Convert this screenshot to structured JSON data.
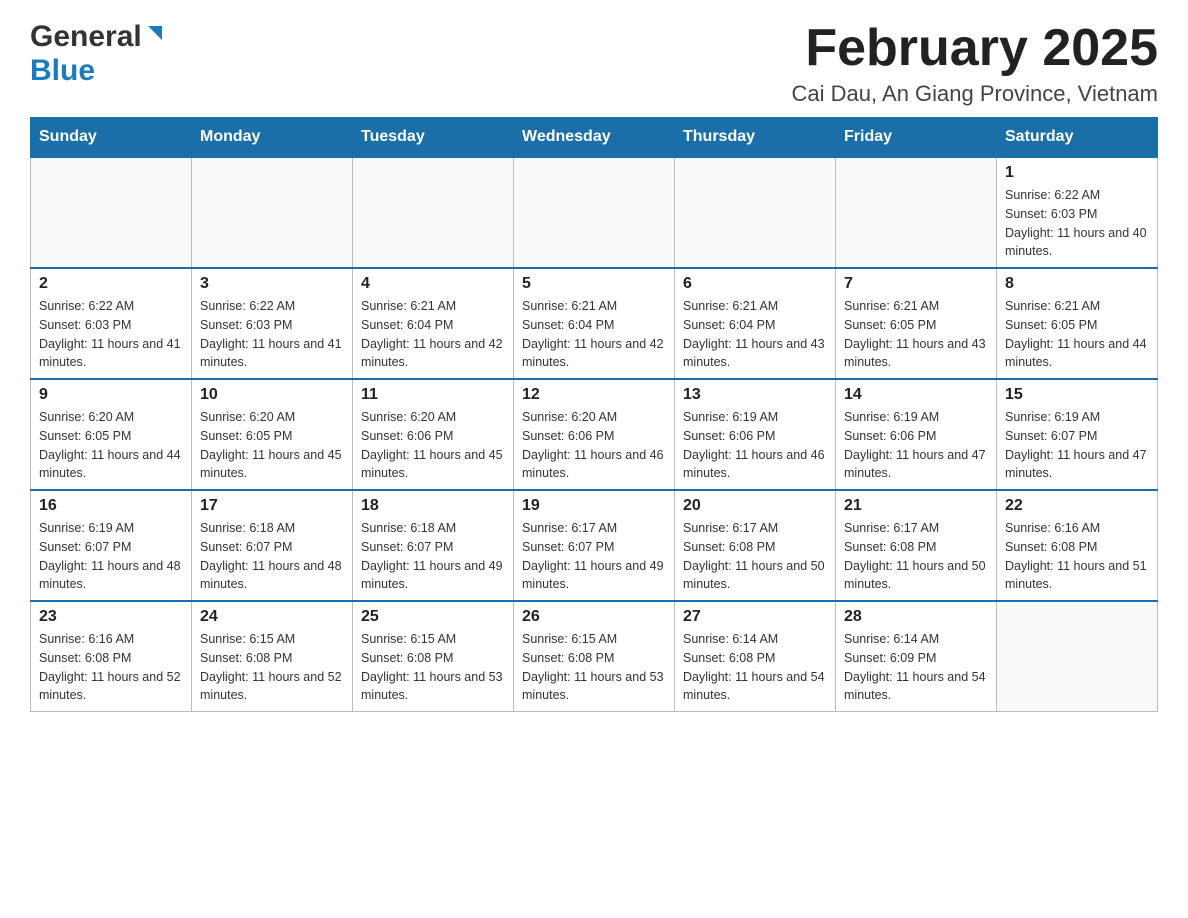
{
  "header": {
    "logo_general": "General",
    "logo_blue": "Blue",
    "month_title": "February 2025",
    "location": "Cai Dau, An Giang Province, Vietnam"
  },
  "days_of_week": [
    "Sunday",
    "Monday",
    "Tuesday",
    "Wednesday",
    "Thursday",
    "Friday",
    "Saturday"
  ],
  "weeks": [
    [
      {
        "day": "",
        "sunrise": "",
        "sunset": "",
        "daylight": ""
      },
      {
        "day": "",
        "sunrise": "",
        "sunset": "",
        "daylight": ""
      },
      {
        "day": "",
        "sunrise": "",
        "sunset": "",
        "daylight": ""
      },
      {
        "day": "",
        "sunrise": "",
        "sunset": "",
        "daylight": ""
      },
      {
        "day": "",
        "sunrise": "",
        "sunset": "",
        "daylight": ""
      },
      {
        "day": "",
        "sunrise": "",
        "sunset": "",
        "daylight": ""
      },
      {
        "day": "1",
        "sunrise": "Sunrise: 6:22 AM",
        "sunset": "Sunset: 6:03 PM",
        "daylight": "Daylight: 11 hours and 40 minutes."
      }
    ],
    [
      {
        "day": "2",
        "sunrise": "Sunrise: 6:22 AM",
        "sunset": "Sunset: 6:03 PM",
        "daylight": "Daylight: 11 hours and 41 minutes."
      },
      {
        "day": "3",
        "sunrise": "Sunrise: 6:22 AM",
        "sunset": "Sunset: 6:03 PM",
        "daylight": "Daylight: 11 hours and 41 minutes."
      },
      {
        "day": "4",
        "sunrise": "Sunrise: 6:21 AM",
        "sunset": "Sunset: 6:04 PM",
        "daylight": "Daylight: 11 hours and 42 minutes."
      },
      {
        "day": "5",
        "sunrise": "Sunrise: 6:21 AM",
        "sunset": "Sunset: 6:04 PM",
        "daylight": "Daylight: 11 hours and 42 minutes."
      },
      {
        "day": "6",
        "sunrise": "Sunrise: 6:21 AM",
        "sunset": "Sunset: 6:04 PM",
        "daylight": "Daylight: 11 hours and 43 minutes."
      },
      {
        "day": "7",
        "sunrise": "Sunrise: 6:21 AM",
        "sunset": "Sunset: 6:05 PM",
        "daylight": "Daylight: 11 hours and 43 minutes."
      },
      {
        "day": "8",
        "sunrise": "Sunrise: 6:21 AM",
        "sunset": "Sunset: 6:05 PM",
        "daylight": "Daylight: 11 hours and 44 minutes."
      }
    ],
    [
      {
        "day": "9",
        "sunrise": "Sunrise: 6:20 AM",
        "sunset": "Sunset: 6:05 PM",
        "daylight": "Daylight: 11 hours and 44 minutes."
      },
      {
        "day": "10",
        "sunrise": "Sunrise: 6:20 AM",
        "sunset": "Sunset: 6:05 PM",
        "daylight": "Daylight: 11 hours and 45 minutes."
      },
      {
        "day": "11",
        "sunrise": "Sunrise: 6:20 AM",
        "sunset": "Sunset: 6:06 PM",
        "daylight": "Daylight: 11 hours and 45 minutes."
      },
      {
        "day": "12",
        "sunrise": "Sunrise: 6:20 AM",
        "sunset": "Sunset: 6:06 PM",
        "daylight": "Daylight: 11 hours and 46 minutes."
      },
      {
        "day": "13",
        "sunrise": "Sunrise: 6:19 AM",
        "sunset": "Sunset: 6:06 PM",
        "daylight": "Daylight: 11 hours and 46 minutes."
      },
      {
        "day": "14",
        "sunrise": "Sunrise: 6:19 AM",
        "sunset": "Sunset: 6:06 PM",
        "daylight": "Daylight: 11 hours and 47 minutes."
      },
      {
        "day": "15",
        "sunrise": "Sunrise: 6:19 AM",
        "sunset": "Sunset: 6:07 PM",
        "daylight": "Daylight: 11 hours and 47 minutes."
      }
    ],
    [
      {
        "day": "16",
        "sunrise": "Sunrise: 6:19 AM",
        "sunset": "Sunset: 6:07 PM",
        "daylight": "Daylight: 11 hours and 48 minutes."
      },
      {
        "day": "17",
        "sunrise": "Sunrise: 6:18 AM",
        "sunset": "Sunset: 6:07 PM",
        "daylight": "Daylight: 11 hours and 48 minutes."
      },
      {
        "day": "18",
        "sunrise": "Sunrise: 6:18 AM",
        "sunset": "Sunset: 6:07 PM",
        "daylight": "Daylight: 11 hours and 49 minutes."
      },
      {
        "day": "19",
        "sunrise": "Sunrise: 6:17 AM",
        "sunset": "Sunset: 6:07 PM",
        "daylight": "Daylight: 11 hours and 49 minutes."
      },
      {
        "day": "20",
        "sunrise": "Sunrise: 6:17 AM",
        "sunset": "Sunset: 6:08 PM",
        "daylight": "Daylight: 11 hours and 50 minutes."
      },
      {
        "day": "21",
        "sunrise": "Sunrise: 6:17 AM",
        "sunset": "Sunset: 6:08 PM",
        "daylight": "Daylight: 11 hours and 50 minutes."
      },
      {
        "day": "22",
        "sunrise": "Sunrise: 6:16 AM",
        "sunset": "Sunset: 6:08 PM",
        "daylight": "Daylight: 11 hours and 51 minutes."
      }
    ],
    [
      {
        "day": "23",
        "sunrise": "Sunrise: 6:16 AM",
        "sunset": "Sunset: 6:08 PM",
        "daylight": "Daylight: 11 hours and 52 minutes."
      },
      {
        "day": "24",
        "sunrise": "Sunrise: 6:15 AM",
        "sunset": "Sunset: 6:08 PM",
        "daylight": "Daylight: 11 hours and 52 minutes."
      },
      {
        "day": "25",
        "sunrise": "Sunrise: 6:15 AM",
        "sunset": "Sunset: 6:08 PM",
        "daylight": "Daylight: 11 hours and 53 minutes."
      },
      {
        "day": "26",
        "sunrise": "Sunrise: 6:15 AM",
        "sunset": "Sunset: 6:08 PM",
        "daylight": "Daylight: 11 hours and 53 minutes."
      },
      {
        "day": "27",
        "sunrise": "Sunrise: 6:14 AM",
        "sunset": "Sunset: 6:08 PM",
        "daylight": "Daylight: 11 hours and 54 minutes."
      },
      {
        "day": "28",
        "sunrise": "Sunrise: 6:14 AM",
        "sunset": "Sunset: 6:09 PM",
        "daylight": "Daylight: 11 hours and 54 minutes."
      },
      {
        "day": "",
        "sunrise": "",
        "sunset": "",
        "daylight": ""
      }
    ]
  ]
}
